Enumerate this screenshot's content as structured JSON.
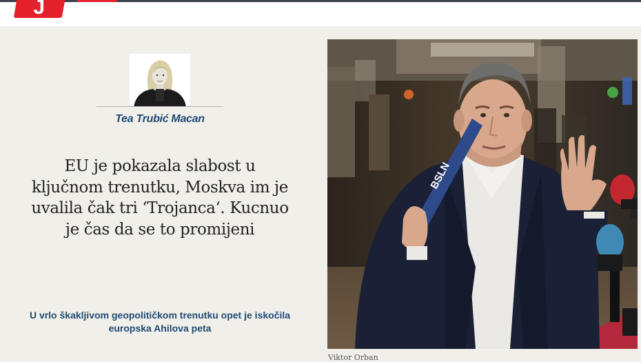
{
  "header": {
    "logo_icon": "brand-logo-icon",
    "brand_color": "#e4202b"
  },
  "author": {
    "name": "Tea Trubić Macan",
    "photo_icon": "author-portrait"
  },
  "article": {
    "headline": "EU je pokazala slabost u ključnom trenutku, Moskva im je uvalila čak tri ‘Trojanca‘. Kucnuo je čas da se to promijeni",
    "subheadline": "U vrlo škakljivom geopolitičkom trenutku opet je iskočila europska Ahilova peta",
    "image_caption": "Viktor Orban"
  },
  "colors": {
    "accent": "#1f4a74",
    "background": "#f1efe9"
  }
}
